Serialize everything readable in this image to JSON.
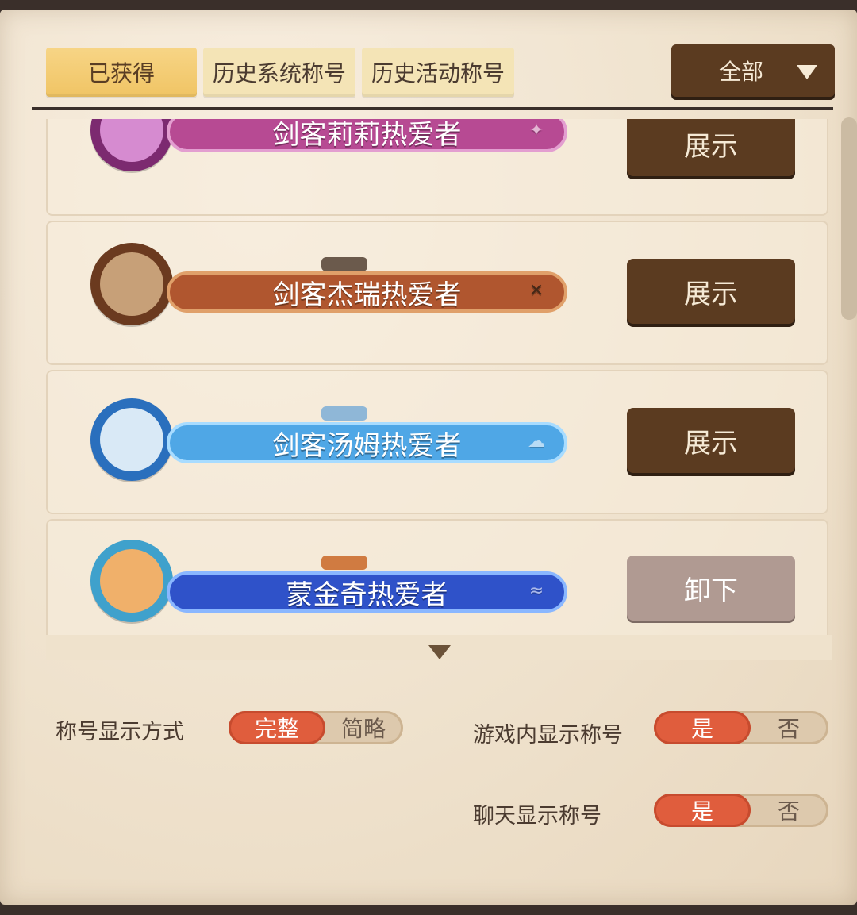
{
  "tabs": [
    "已获得",
    "历史系统称号",
    "历史活动称号"
  ],
  "filter": {
    "label": "全部"
  },
  "titles": [
    {
      "name": "剑客莉莉热爱者",
      "action": "展示",
      "theme": "#b74a93",
      "border": "#e39ed0"
    },
    {
      "name": "剑客杰瑞热爱者",
      "action": "展示",
      "theme": "#b0562f",
      "border": "#e0a06a"
    },
    {
      "name": "剑客汤姆热爱者",
      "action": "展示",
      "theme": "#4fa7e6",
      "border": "#a8dcff"
    },
    {
      "name": "蒙金奇热爱者",
      "action": "卸下",
      "theme": "#2f52c9",
      "border": "#8ab7ff"
    }
  ],
  "settings": {
    "display_mode": {
      "label": "称号显示方式",
      "on": "完整",
      "off": "简略"
    },
    "in_game": {
      "label": "游戏内显示称号",
      "on": "是",
      "off": "否"
    },
    "chat": {
      "label": "聊天显示称号",
      "on": "是",
      "off": "否"
    }
  },
  "icons": {
    "badge_1": "sword-lily-icon",
    "badge_2": "sword-jerry-icon",
    "badge_3": "hat-tom-icon",
    "badge_4": "treasure-icon",
    "dropdown": "triangle-down-icon",
    "scroll": "triangle-down-icon"
  }
}
